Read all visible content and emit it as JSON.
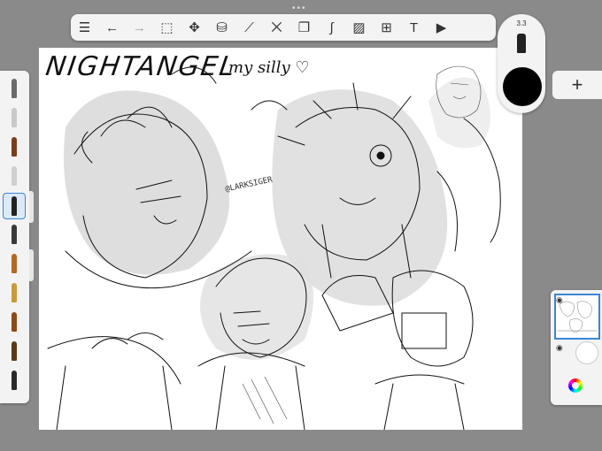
{
  "canvas": {
    "title_ink": "NIGHTANGEL",
    "subtitle_ink": "my silly ♡",
    "watermark": "@LARKSIGER"
  },
  "toolbar": {
    "tools": [
      {
        "name": "gallery-icon",
        "glyph": "☰"
      },
      {
        "name": "undo-icon",
        "glyph": "←"
      },
      {
        "name": "redo-icon",
        "glyph": "→"
      },
      {
        "name": "selection-icon",
        "glyph": "⬚"
      },
      {
        "name": "transform-icon",
        "glyph": "✥"
      },
      {
        "name": "fill-icon",
        "glyph": "⛁"
      },
      {
        "name": "ruler-icon",
        "glyph": "⟋"
      },
      {
        "name": "symmetry-icon",
        "glyph": "⨉"
      },
      {
        "name": "shapes-icon",
        "glyph": "❐"
      },
      {
        "name": "curve-icon",
        "glyph": "∫"
      },
      {
        "name": "image-icon",
        "glyph": "▨"
      },
      {
        "name": "perspective-icon",
        "glyph": "⊞"
      },
      {
        "name": "text-icon",
        "glyph": "T"
      },
      {
        "name": "video-icon",
        "glyph": "▶"
      }
    ],
    "handle": "•••"
  },
  "brushes": {
    "colors": [
      "#6a6a6a",
      "#c9c9c9",
      "#7a3e1e",
      "#d0d0d0",
      "#222222",
      "#3a3a3a",
      "#b06a2a",
      "#c89a3a",
      "#8a4a1a",
      "#5a3a1a",
      "#2a2a2a"
    ],
    "selected_index": 4
  },
  "color_puck": {
    "size_label": "3.3",
    "current_color": "#000000"
  },
  "layers": {
    "add_label": "+"
  }
}
